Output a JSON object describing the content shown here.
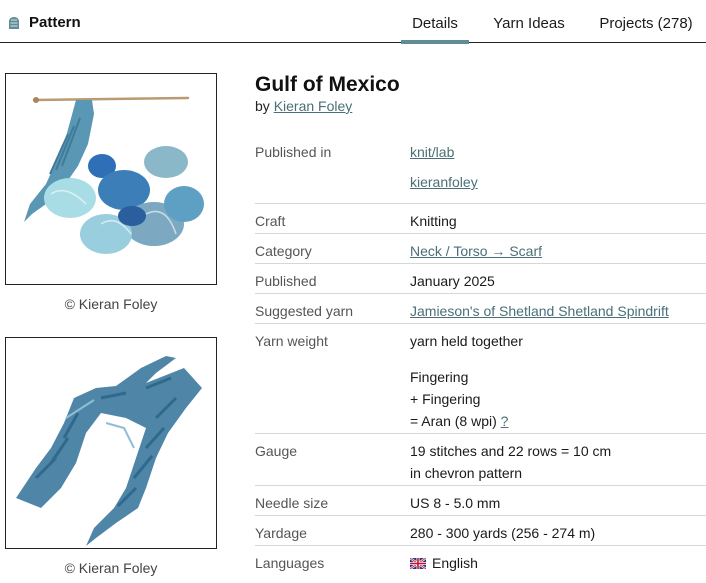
{
  "header": {
    "brand_label": "Pattern",
    "tabs": [
      {
        "label": "Details",
        "active": true
      },
      {
        "label": "Yarn Ideas",
        "active": false
      },
      {
        "label": "Projects (278)",
        "active": false
      }
    ]
  },
  "photos": [
    {
      "caption": "© Kieran Foley"
    },
    {
      "caption": "© Kieran Foley"
    }
  ],
  "pattern": {
    "title": "Gulf of Mexico",
    "by_prefix": "by",
    "author": "Kieran Foley"
  },
  "details": {
    "published_in": {
      "label": "Published in",
      "values": [
        "knit/lab",
        "kieranfoley"
      ]
    },
    "craft": {
      "label": "Craft",
      "value": "Knitting"
    },
    "category": {
      "label": "Category",
      "value": "Neck / Torso → Scarf"
    },
    "published": {
      "label": "Published",
      "value": "January 2025"
    },
    "suggested_yarn": {
      "label": "Suggested yarn",
      "value": "Jamieson's of Shetland Shetland Spindrift"
    },
    "yarn_weight": {
      "label": "Yarn weight",
      "line1": "yarn held together",
      "line2": "Fingering",
      "line3": "+ Fingering",
      "line4": "= Aran (8 wpi)",
      "help": "?"
    },
    "gauge": {
      "label": "Gauge",
      "line1": "19 stitches and 22 rows = 10 cm",
      "line2": "in chevron pattern"
    },
    "needle_size": {
      "label": "Needle size",
      "value": "US 8 - 5.0 mm"
    },
    "yardage": {
      "label": "Yardage",
      "value": "280 - 300 yards (256 - 274 m)"
    },
    "languages": {
      "label": "Languages",
      "value": "English"
    }
  },
  "colors": {
    "accent": "#5f8c96",
    "link": "#4a6f78"
  }
}
